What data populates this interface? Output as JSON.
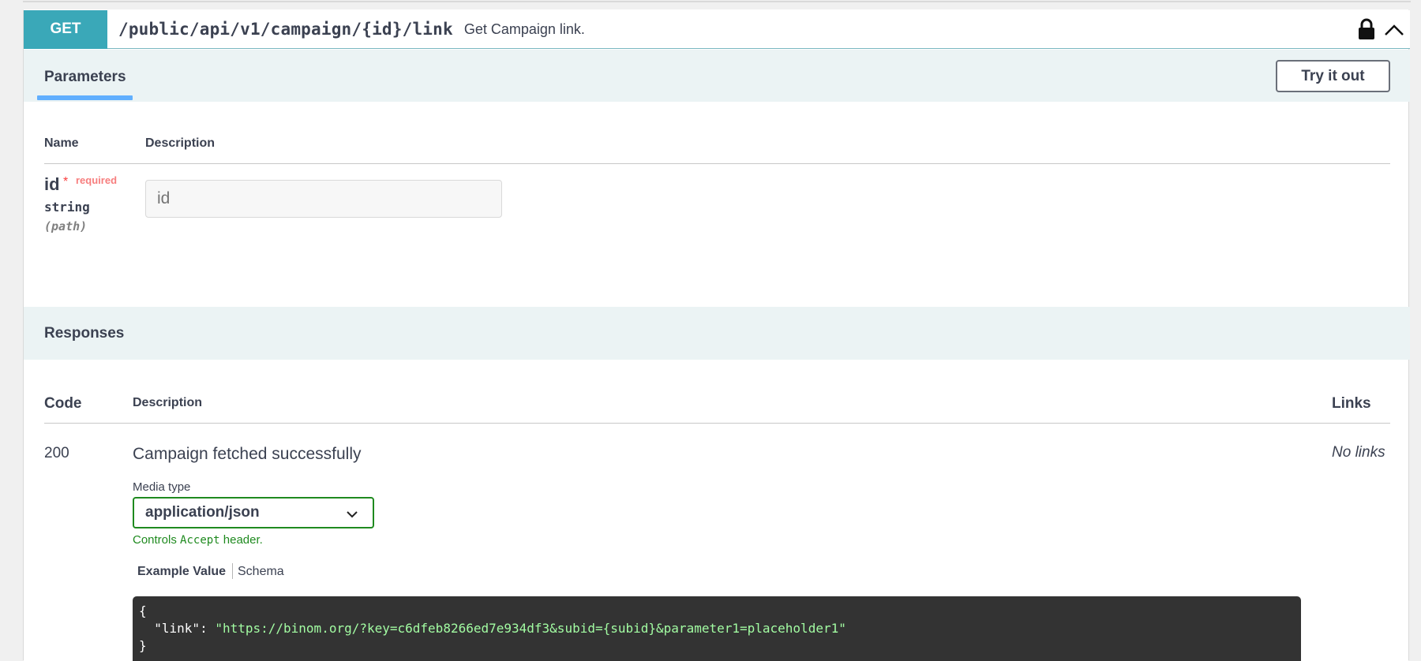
{
  "operation": {
    "method": "GET",
    "path": "/public/api/v1/campaign/{id}/link",
    "summary": "Get Campaign link."
  },
  "parameters": {
    "section_title": "Parameters",
    "try_button": "Try it out",
    "col_name": "Name",
    "col_description": "Description",
    "items": [
      {
        "name": "id",
        "required_mark": "*",
        "required_label": "required",
        "type": "string",
        "in": "(path)",
        "placeholder": "id"
      }
    ]
  },
  "responses": {
    "section_title": "Responses",
    "col_code": "Code",
    "col_description": "Description",
    "col_links": "Links",
    "items": [
      {
        "code": "200",
        "description": "Campaign fetched successfully",
        "links": "No links",
        "media_type_label": "Media type",
        "media_type_value": "application/json",
        "controls_prefix": "Controls",
        "controls_code": "Accept",
        "controls_suffix": "header.",
        "tab_example": "Example Value",
        "tab_schema": "Schema",
        "example": {
          "open": "{",
          "key": "  \"link\": ",
          "value": "\"https://binom.org/?key=c6dfeb8266ed7e934df3&subid={subid}&parameter1=placeholder1\"",
          "close": "}"
        }
      }
    ]
  },
  "icons": {
    "lock": "lock-icon",
    "collapse": "chevron-up-icon",
    "select": "chevron-down-icon"
  },
  "colors": {
    "get_method": "#3aa8b8",
    "section_bg": "#ebf3f4",
    "tab_underline": "#61affe",
    "required": "#f93e3e",
    "select_border": "#1f8a1f",
    "code_bg": "#333333",
    "code_string": "#a2fca2"
  }
}
